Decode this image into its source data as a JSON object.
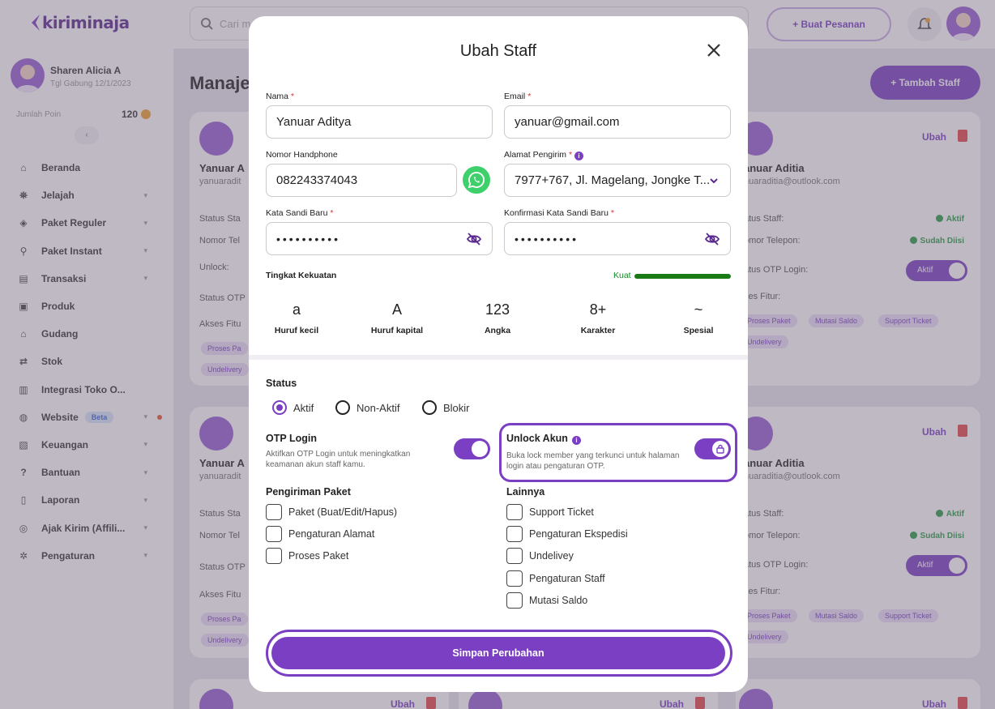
{
  "app": {
    "logo": "kiriminaja",
    "search_placeholder": "Cari m",
    "order_button": "+ Buat Pesanan",
    "page_title": "Manaje",
    "add_staff_button": "+ Tambah Staff"
  },
  "sidebar": {
    "user_name": "Sharen Alicia A",
    "join_date": "Tgl Gabung 12/1/2023",
    "poin_label": "Jumlah Poin",
    "poin_value": "120",
    "collapse_symbol": "‹",
    "items": [
      {
        "label": "Beranda",
        "icon": "home-icon",
        "chevron": false
      },
      {
        "label": "Jelajah",
        "icon": "explore-icon",
        "chevron": true
      },
      {
        "label": "Paket Reguler",
        "icon": "package-icon",
        "chevron": true
      },
      {
        "label": "Paket Instant",
        "icon": "bike-icon",
        "chevron": true
      },
      {
        "label": "Transaksi",
        "icon": "transaction-icon",
        "chevron": true
      },
      {
        "label": "Produk",
        "icon": "product-icon",
        "chevron": false
      },
      {
        "label": "Gudang",
        "icon": "warehouse-icon",
        "chevron": false
      },
      {
        "label": "Stok",
        "icon": "stock-icon",
        "chevron": false
      },
      {
        "label": "Integrasi Toko O...",
        "icon": "store-icon",
        "chevron": false
      },
      {
        "label": "Website",
        "icon": "globe-icon",
        "chevron": true,
        "badge": "Beta"
      },
      {
        "label": "Keuangan",
        "icon": "finance-icon",
        "chevron": true
      },
      {
        "label": "Bantuan",
        "icon": "help-icon",
        "chevron": true
      },
      {
        "label": "Laporan",
        "icon": "report-icon",
        "chevron": true
      },
      {
        "label": "Ajak Kirim (Affili...",
        "icon": "affiliate-icon",
        "chevron": true
      },
      {
        "label": "Pengaturan",
        "icon": "settings-icon",
        "chevron": true
      }
    ]
  },
  "bg_cards": {
    "name_left": "Yanuar A",
    "mail_left": "yanuaradit",
    "name_right": "anuar Aditia",
    "mail_right": "nuaraditia@outlook.com",
    "status_staff_left": "Status Sta",
    "phone_left": "Nomor Tel",
    "unlock_left": "Unlock:",
    "otp_left": "Status OTP",
    "akses_left": "Akses Fitu",
    "status_staff_right": "atus Staff:",
    "phone_right": "omor Telepon:",
    "otp_right": "atus OTP Login:",
    "akses_right": "ses Fitur:",
    "aktif": "Aktif",
    "sudah_diisi": "Sudah Diisi",
    "toggle_label": "Aktif",
    "edit": "Ubah",
    "chip_proses": "Proses Paket",
    "chip_undelivery": "Undelivery",
    "chip_proses_short": "Proses Pa",
    "chip_undelivery_short": "Undelivery",
    "chip_mutasi": "Mutasi Saldo",
    "chip_support": "Support Ticket"
  },
  "modal": {
    "title": "Ubah Staff",
    "fields": {
      "nama_label": "Nama",
      "nama_value": "Yanuar Aditya",
      "email_label": "Email",
      "email_value": "yanuar@gmail.com",
      "phone_label": "Nomor Handphone",
      "phone_value": "082243374043",
      "alamat_label": "Alamat Pengirim",
      "alamat_value": "7977+767, Jl. Magelang, Jongke T...",
      "password_label": "Kata Sandi Baru",
      "password_value": "••••••••••",
      "confirm_label": "Konfirmasi Kata Sandi Baru",
      "confirm_value": "••••••••••",
      "required_mark": "*"
    },
    "strength": {
      "label": "Tingkat Kekuatan",
      "level": "Kuat",
      "level_fraction": 1.0,
      "requirements": [
        {
          "symbol": "a",
          "label": "Huruf kecil"
        },
        {
          "symbol": "A",
          "label": "Huruf kapital"
        },
        {
          "symbol": "123",
          "label": "Angka"
        },
        {
          "symbol": "8+",
          "label": "Karakter"
        },
        {
          "symbol": "~",
          "label": "Spesial"
        }
      ]
    },
    "status": {
      "label": "Status",
      "options": [
        "Aktif",
        "Non-Aktif",
        "Blokir"
      ],
      "selected": "Aktif"
    },
    "otp": {
      "title": "OTP Login",
      "desc": "Aktifkan OTP Login untuk meningkatkan keamanan akun staff kamu.",
      "on": true
    },
    "unlock": {
      "title": "Unlock Akun",
      "desc": "Buka lock member yang terkunci untuk halaman login atau pengaturan OTP.",
      "on": true
    },
    "pengiriman": {
      "title": "Pengiriman Paket",
      "items": [
        "Paket (Buat/Edit/Hapus)",
        "Pengaturan Alamat",
        "Proses Paket"
      ]
    },
    "lainnya": {
      "title": "Lainnya",
      "items": [
        "Support Ticket",
        "Pengaturan Ekspedisi",
        "Undelivey",
        "Pengaturan Staff",
        "Mutasi Saldo"
      ]
    },
    "save_button": "Simpan Perubahan"
  },
  "colors": {
    "primary": "#7b3fc4",
    "success": "#1a7a16",
    "whatsapp": "#3ed06b",
    "required": "#e03030"
  }
}
